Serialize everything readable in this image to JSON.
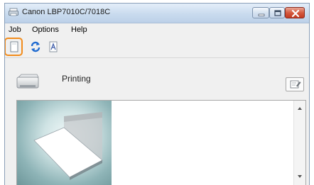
{
  "window": {
    "title": "Canon LBP7010C/7018C"
  },
  "menu": {
    "items": [
      "Job",
      "Options",
      "Help"
    ]
  },
  "toolbar": {
    "buttons": [
      "queue-icon",
      "refresh-icon",
      "print-settings-icon"
    ],
    "highlight_color": "#f28c1c"
  },
  "status": {
    "text": "Printing",
    "icon": "printer-icon"
  },
  "colors": {
    "title_gradient_top": "#e4eef9",
    "close_button": "#c23b22",
    "window_background": "#f0f0f0",
    "pane_background": "#ffffff"
  }
}
